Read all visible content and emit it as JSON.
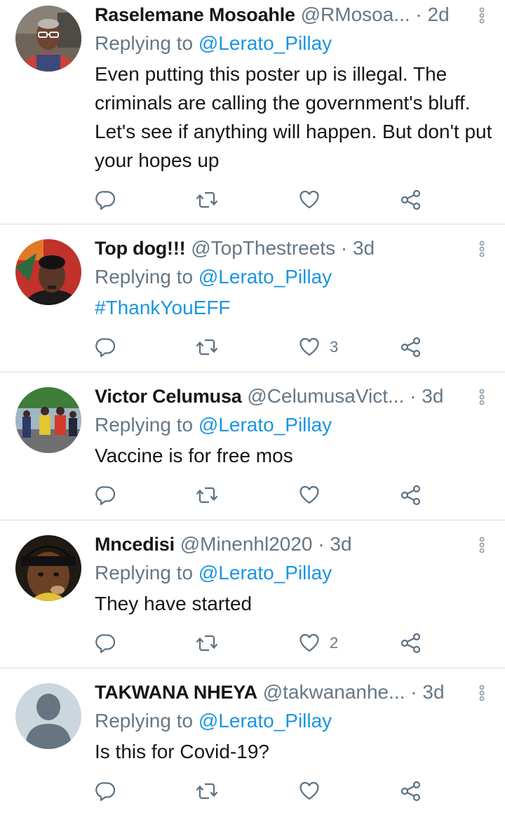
{
  "colors": {
    "name": "#14171a",
    "secondary": "#657786",
    "link": "#1b95e0",
    "icon": "#5b7083",
    "divider": "#d5d9dc"
  },
  "tweets": [
    {
      "name": "Raselemane Mosoahle",
      "handle": "@RMosoa...",
      "dot": "·",
      "time": "2d",
      "reply_prefix": "Replying to",
      "reply_to": "@Lerato_Pillay",
      "text": "Even putting this poster up is illegal. The criminals are calling the government's bluff. Let's see if anything will happen. But don't put your hopes up",
      "likes": "",
      "avatar": "man-glasses-photo"
    },
    {
      "name": "Top dog!!!",
      "handle": "@TopThestreets",
      "dot": "·",
      "time": "3d",
      "reply_prefix": "Replying to",
      "reply_to": "@Lerato_Pillay",
      "text": "#ThankYouEFF",
      "likes": "3",
      "avatar": "man-red-background-photo"
    },
    {
      "name": "Victor Celumusa",
      "handle": "@CelumusaVict...",
      "dot": "·",
      "time": "3d",
      "reply_prefix": "Replying to",
      "reply_to": "@Lerato_Pillay",
      "text": "Vaccine is for free mos",
      "likes": "",
      "avatar": "street-group-photo"
    },
    {
      "name": "Mncedisi",
      "handle": "@Minenhl2020",
      "dot": "·",
      "time": "3d",
      "reply_prefix": "Replying to",
      "reply_to": "@Lerato_Pillay",
      "text": "They have started",
      "likes": "2",
      "avatar": "child-photo"
    },
    {
      "name": "TAKWANA NHEYA",
      "handle": "@takwananhe...",
      "dot": "·",
      "time": "3d",
      "reply_prefix": "Replying to",
      "reply_to": "@Lerato_Pillay",
      "text": "Is this for Covid-19?",
      "likes": "",
      "avatar": "default-profile-silhouette"
    }
  ]
}
